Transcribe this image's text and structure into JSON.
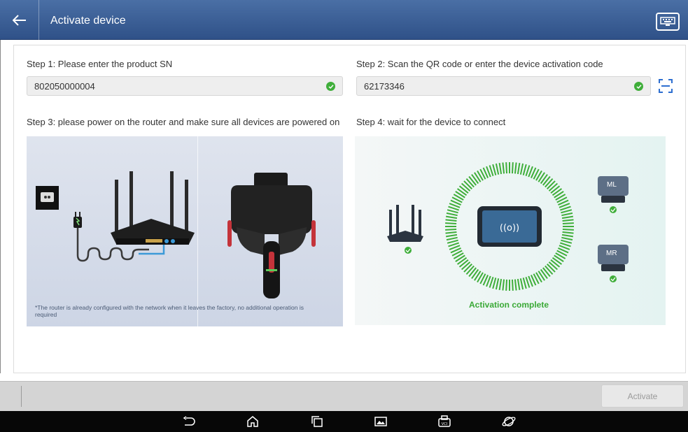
{
  "header": {
    "title": "Activate device",
    "back_icon": "back-arrow-icon",
    "keyboard_icon": "keyboard-icon"
  },
  "step1": {
    "label": "Step 1: Please enter the product SN",
    "value": "802050000004",
    "status_icon": "check-circle-icon"
  },
  "step2": {
    "label": "Step 2: Scan the QR code or enter the device activation code",
    "value": "62173346",
    "status_icon": "check-circle-icon",
    "scan_icon": "scan-icon"
  },
  "step3": {
    "label": "Step 3: please power on the router and make sure all devices are powered on",
    "note": "*The router is already configured with the network when it leaves the factory, no additional operation is required"
  },
  "step4": {
    "label": "Step 4: wait for the device to connect",
    "status": "Activation complete",
    "device_left": "ML",
    "device_right": "MR"
  },
  "actions": {
    "activate_label": "Activate"
  },
  "navbar": {
    "icons": [
      "back-icon",
      "home-icon",
      "recents-icon",
      "gallery-icon",
      "vci-icon",
      "browser-icon"
    ]
  },
  "colors": {
    "header": "#2f5188",
    "accent_blue": "#2e6fd0",
    "success_green": "#3fae3a"
  }
}
